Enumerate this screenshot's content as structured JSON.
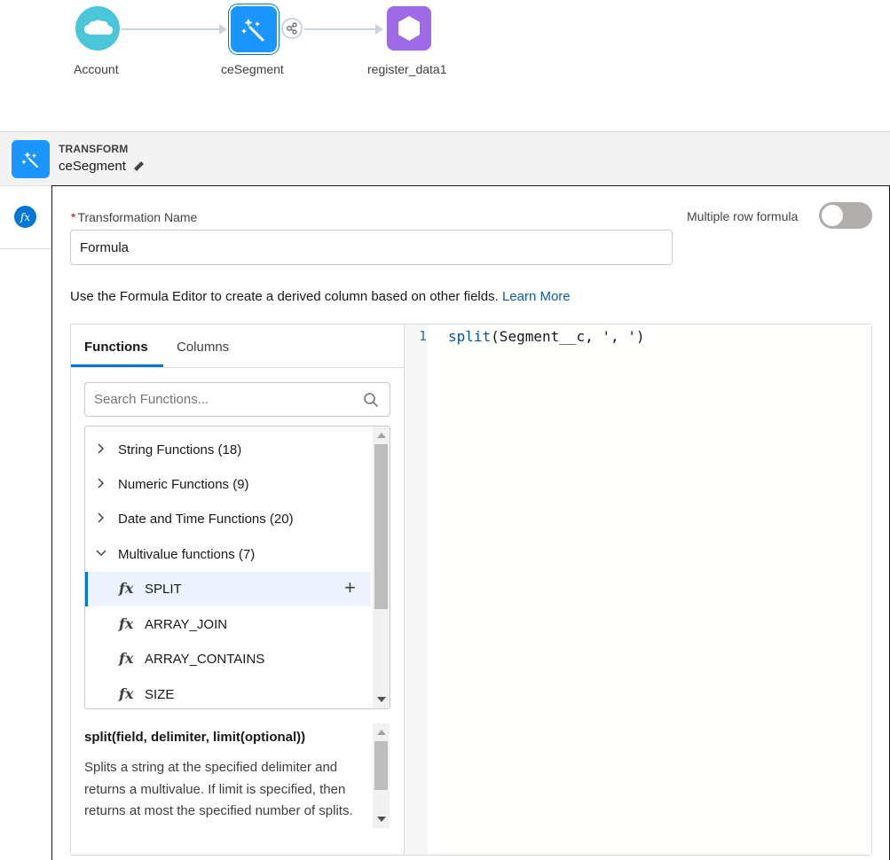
{
  "flow": {
    "nodes": [
      {
        "label": "Account",
        "icon": "salesforce-cloud-icon"
      },
      {
        "label": "ceSegment",
        "icon": "transform-wand-icon"
      },
      {
        "label": "register_data1",
        "icon": "hexagon-icon"
      }
    ]
  },
  "transform": {
    "type_label": "TRANSFORM",
    "name": "ceSegment"
  },
  "form": {
    "name_label": "Transformation Name",
    "name_value": "Formula",
    "multirow_label": "Multiple row formula",
    "multirow_on": false,
    "helper_text": "Use the Formula Editor to create a derived column based on other fields.",
    "learn_more": "Learn More"
  },
  "tabs": {
    "functions": "Functions",
    "columns": "Columns"
  },
  "search": {
    "placeholder": "Search Functions..."
  },
  "categories": [
    {
      "label": "String Functions (18)",
      "expanded": false
    },
    {
      "label": "Numeric Functions (9)",
      "expanded": false
    },
    {
      "label": "Date and Time Functions (20)",
      "expanded": false
    },
    {
      "label": "Multivalue functions (7)",
      "expanded": true
    }
  ],
  "functions": [
    "SPLIT",
    "ARRAY_JOIN",
    "ARRAY_CONTAINS",
    "SIZE"
  ],
  "fx_symbol": "fx",
  "doc": {
    "signature": "split(field, delimiter, limit(optional))",
    "description": "Splits a string at the specified delimiter and returns a multivalue. If limit is specified, then returns at most the specified number of splits."
  },
  "editor": {
    "line_number": "1",
    "fn": "split",
    "args": "(Segment__c, ', ')"
  },
  "colors": {
    "accent": "#0176d3",
    "account": "#4bc6d9",
    "transform": "#1b96ff",
    "output": "#9e6ae6"
  }
}
